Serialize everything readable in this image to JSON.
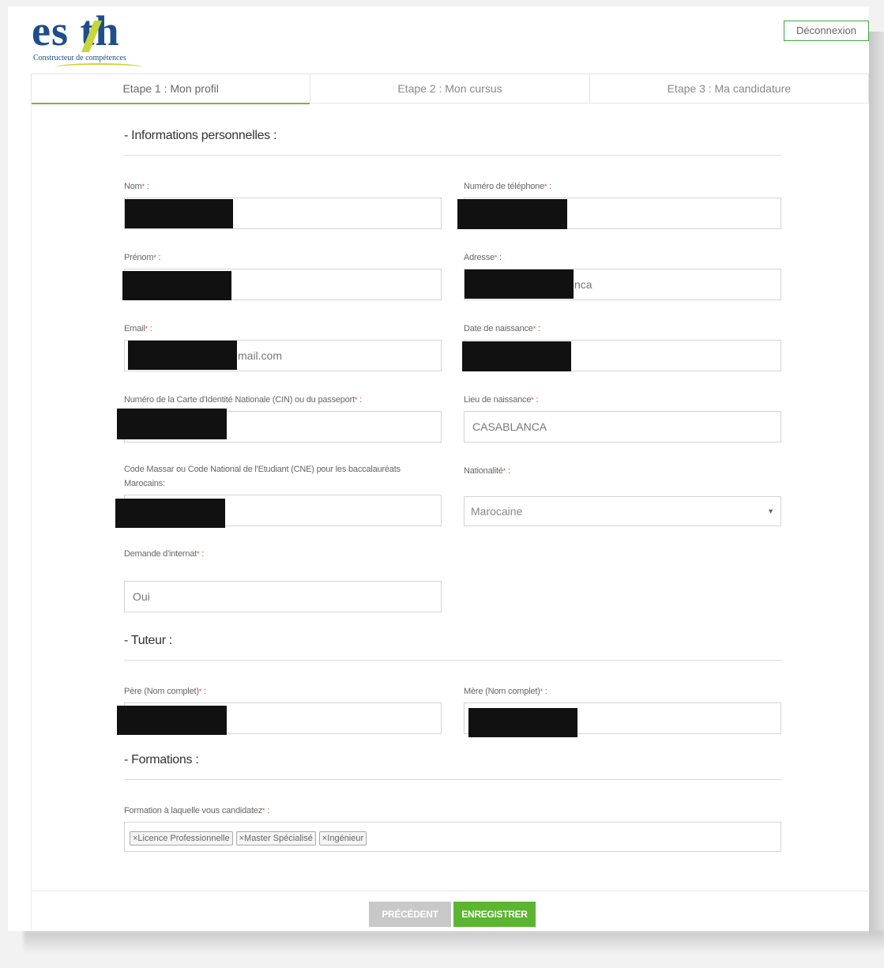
{
  "header": {
    "logo_text": "es th",
    "logo_tagline": "Constructeur de compétences",
    "logout_label": "Déconnexion"
  },
  "steps": [
    {
      "label": "Etape 1 : Mon profil"
    },
    {
      "label": "Etape 2 : Mon cursus"
    },
    {
      "label": "Etape 3 : Ma candidature"
    }
  ],
  "sections": {
    "personal": "- Informations personnelles :",
    "tutor": "- Tuteur :",
    "formations": "- Formations :"
  },
  "fields": {
    "nom": {
      "label": "Nom",
      "value": ""
    },
    "telephone": {
      "label": "Numéro de téléphone",
      "value": ""
    },
    "prenom": {
      "label": "Prénom",
      "value": ""
    },
    "adresse": {
      "label": "Adresse",
      "value": "nca"
    },
    "email": {
      "label": "Email",
      "value": "mail.com"
    },
    "date_naissance": {
      "label": "Date de naissance",
      "value": ""
    },
    "cin": {
      "label": "Numéro de la Carte d'Identité Nationale (CIN) ou du passeport",
      "value": ""
    },
    "lieu_naissance": {
      "label": "Lieu de naissance",
      "value": "CASABLANCA"
    },
    "cne": {
      "label": "Code Massar ou Code National de l'Etudiant (CNE) pour les baccalauréats Marocains:",
      "value": ""
    },
    "nationalite": {
      "label": "Nationalité",
      "value": "Marocaine"
    },
    "internat": {
      "label": "Demande d'internat",
      "value": "Oui"
    },
    "pere": {
      "label": "Père (Nom complet)",
      "value": ""
    },
    "mere": {
      "label": "Mère (Nom complet)",
      "value": ""
    },
    "formation": {
      "label": "Formation à laquelle vous candidatez"
    }
  },
  "required_marker": "*",
  "label_suffix": " :",
  "formation_tags": [
    "×Licence Professionnelle",
    "×Master Spécialisé",
    "×Ingénieur"
  ],
  "buttons": {
    "previous": "PRÉCÉDENT",
    "save": "ENREGISTRER"
  },
  "colors": {
    "brand_blue": "#1f4e8a",
    "brand_lime": "#c7d63a",
    "accent_green": "#5cb531",
    "disabled_gray": "#c8c8c8",
    "required_red": "#e53935"
  }
}
